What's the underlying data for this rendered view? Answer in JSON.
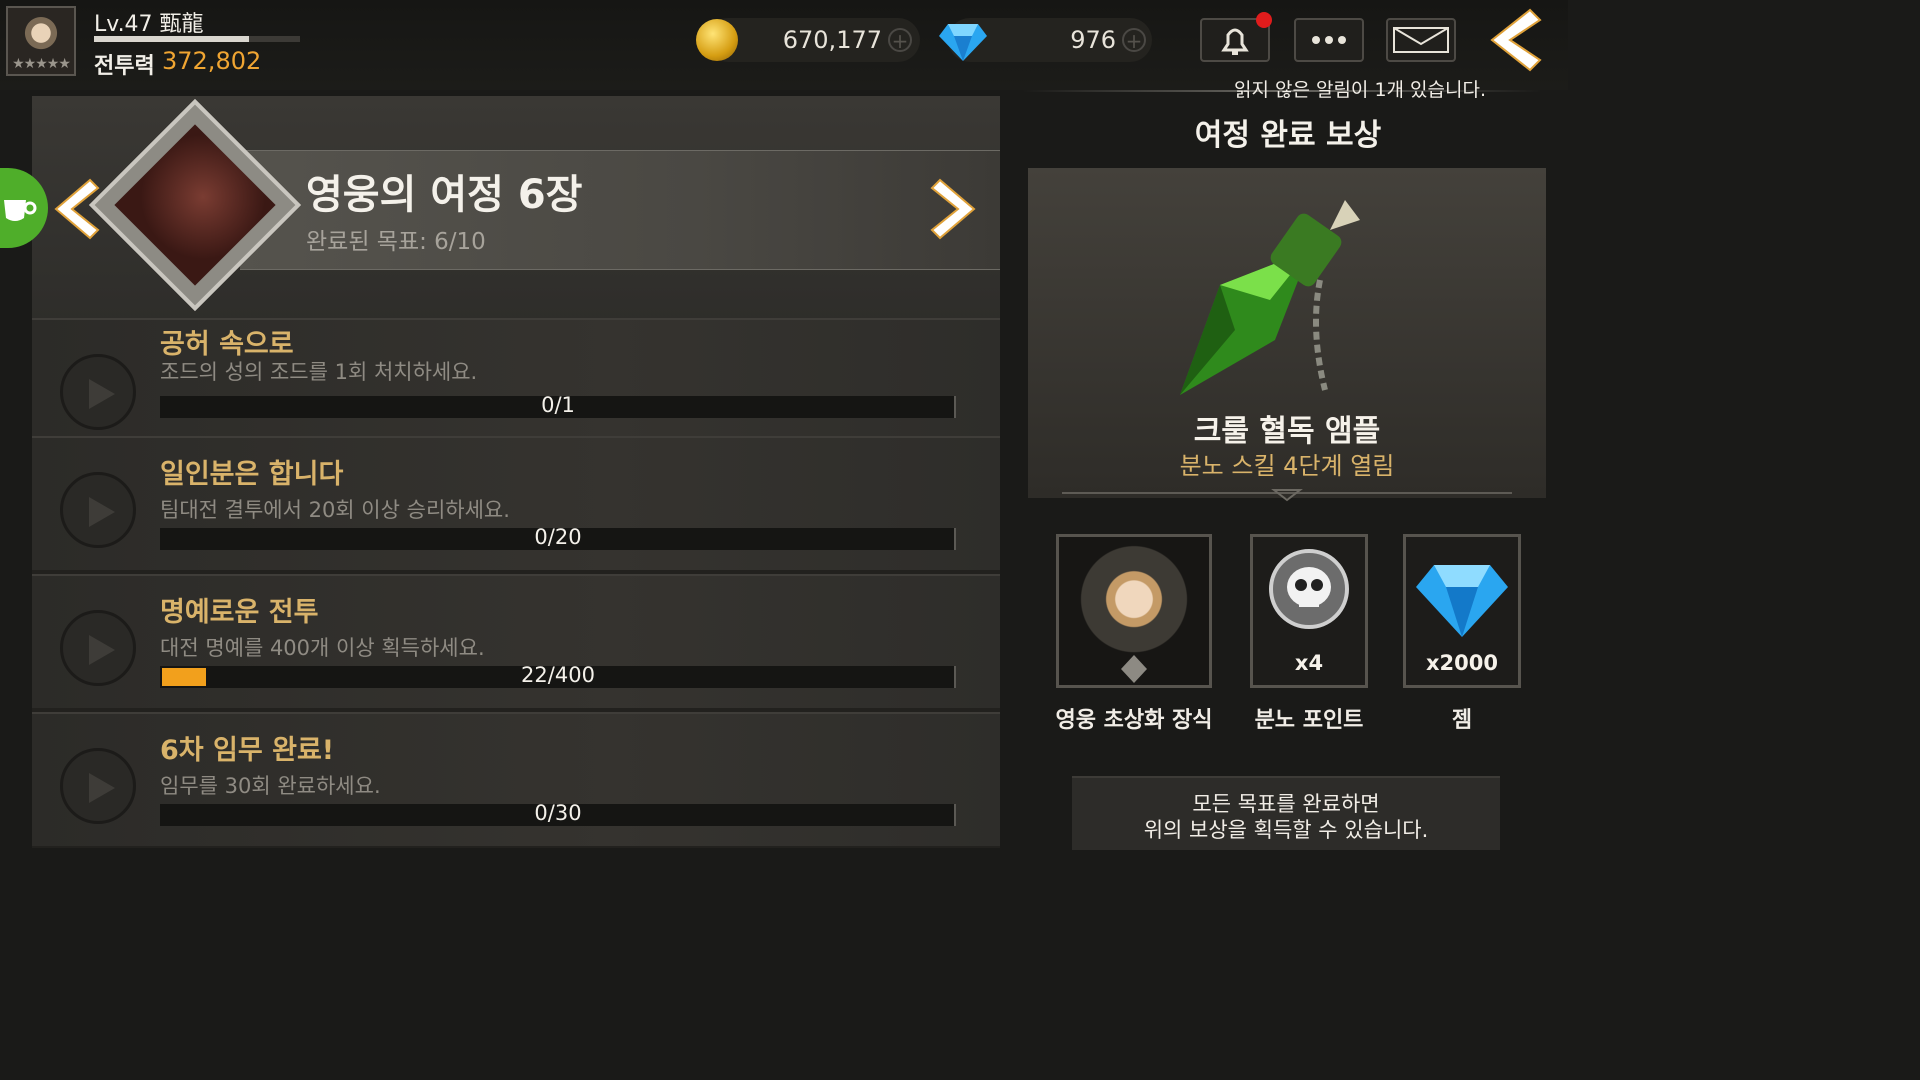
{
  "player": {
    "level_name": "Lv.47 甄龍",
    "power_label": "전투력",
    "power_value": "372,802",
    "avatar_stars": "★★★★★",
    "exp_progress": 0.75
  },
  "currency": {
    "gold": "670,177",
    "gems": "976",
    "gold_icon": "gold-coin-icon",
    "gem_icon": "blue-gem-icon"
  },
  "notifications": {
    "notice_text": "읽지 않은 알림이 1개 있습니다."
  },
  "chapter": {
    "title": "영웅의 여정 6장",
    "progress_text": "완료된 목표: 6/10"
  },
  "quests": [
    {
      "title": "공허 속으로",
      "desc": "조드의 성의 조드를 1회 처치하세요.",
      "count": "0/1",
      "progress": 0
    },
    {
      "title": "일인분은 합니다",
      "desc": "팀대전 결투에서 20회 이상 승리하세요.",
      "count": "0/20",
      "progress": 0
    },
    {
      "title": "명예로운 전투",
      "desc": "대전 명예를 400개 이상 획득하세요.",
      "count": "22/400",
      "progress": 0.055
    },
    {
      "title": "6차 임무 완료!",
      "desc": "임무를 30회 완료하세요.",
      "count": "0/30",
      "progress": 0
    }
  ],
  "reward": {
    "section_title": "여정 완료 보상",
    "main_name": "크룰 혈독 앰플",
    "main_desc": "분노 스킬 4단계 열림",
    "items": [
      {
        "label": "영웅 초상화 장식",
        "count": ""
      },
      {
        "label": "분노 포인트",
        "count": "x4"
      },
      {
        "label": "젬",
        "count": "x2000"
      }
    ],
    "footer_line1": "모든 목표를 완료하면",
    "footer_line2": "위의 보상을 획득할 수 있습니다."
  },
  "colors": {
    "accent_gold": "#d9b36a",
    "progress_orange": "#f2a01c",
    "notify_red": "#e01c1c",
    "power_orange": "#f0a532"
  }
}
